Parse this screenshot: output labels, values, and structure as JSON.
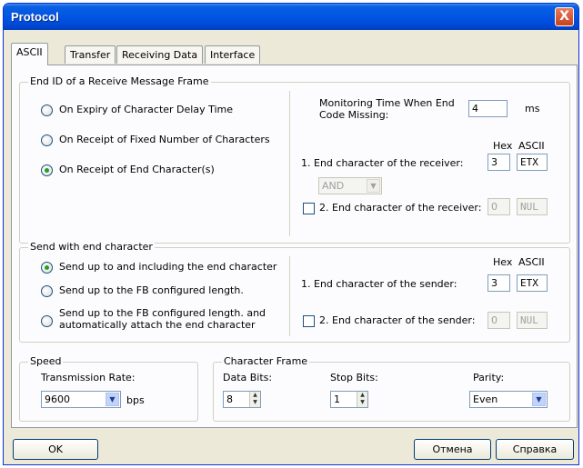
{
  "window": {
    "title": "Protocol",
    "close_glyph": "X"
  },
  "tabs": [
    "ASCII",
    "Transfer",
    "Receiving Data",
    "Interface"
  ],
  "end_id": {
    "title": "End ID of a Receive Message Frame",
    "options": [
      "On Expiry of Character Delay Time",
      "On Receipt of Fixed Number of Characters",
      "On Receipt of End Character(s)"
    ],
    "selected_index": 2,
    "monitoring_label_1": "Monitoring Time When End",
    "monitoring_label_2": "Code Missing:",
    "monitoring_value": "4",
    "monitoring_unit": "ms",
    "hex_header": "Hex",
    "ascii_header": "ASCII",
    "end_char_1_label": "1. End character of the receiver:",
    "end_char_1_hex": "3",
    "end_char_1_ascii": "ETX",
    "logic_value": "AND",
    "end_char_2_label": "2. End character of the receiver:",
    "end_char_2_checked": false,
    "end_char_2_hex": "0",
    "end_char_2_ascii": "NUL"
  },
  "send_end": {
    "title": "Send with end character",
    "options": [
      "Send up to and including the end character",
      "Send up to the FB configured length.",
      "Send up to the FB configured length. and",
      "automatically attach the end character"
    ],
    "selected_index": 0,
    "hex_header": "Hex",
    "ascii_header": "ASCII",
    "end_char_1_label": "1. End character of the sender:",
    "end_char_1_hex": "3",
    "end_char_1_ascii": "ETX",
    "end_char_2_label": "2. End character of the sender:",
    "end_char_2_checked": false,
    "end_char_2_hex": "0",
    "end_char_2_ascii": "NUL"
  },
  "speed": {
    "title": "Speed",
    "rate_label": "Transmission Rate:",
    "rate_value": "9600",
    "rate_unit": "bps"
  },
  "frame": {
    "title": "Character Frame",
    "data_bits_label": "Data Bits:",
    "data_bits_value": "8",
    "stop_bits_label": "Stop Bits:",
    "stop_bits_value": "1",
    "parity_label": "Parity:",
    "parity_value": "Even"
  },
  "buttons": {
    "ok": "OK",
    "cancel": "Отмена",
    "help": "Справка"
  },
  "colors": {
    "title_bar": "#0055e5",
    "dialog_bg": "#ece9d8",
    "radio_dot": "#21a121"
  }
}
